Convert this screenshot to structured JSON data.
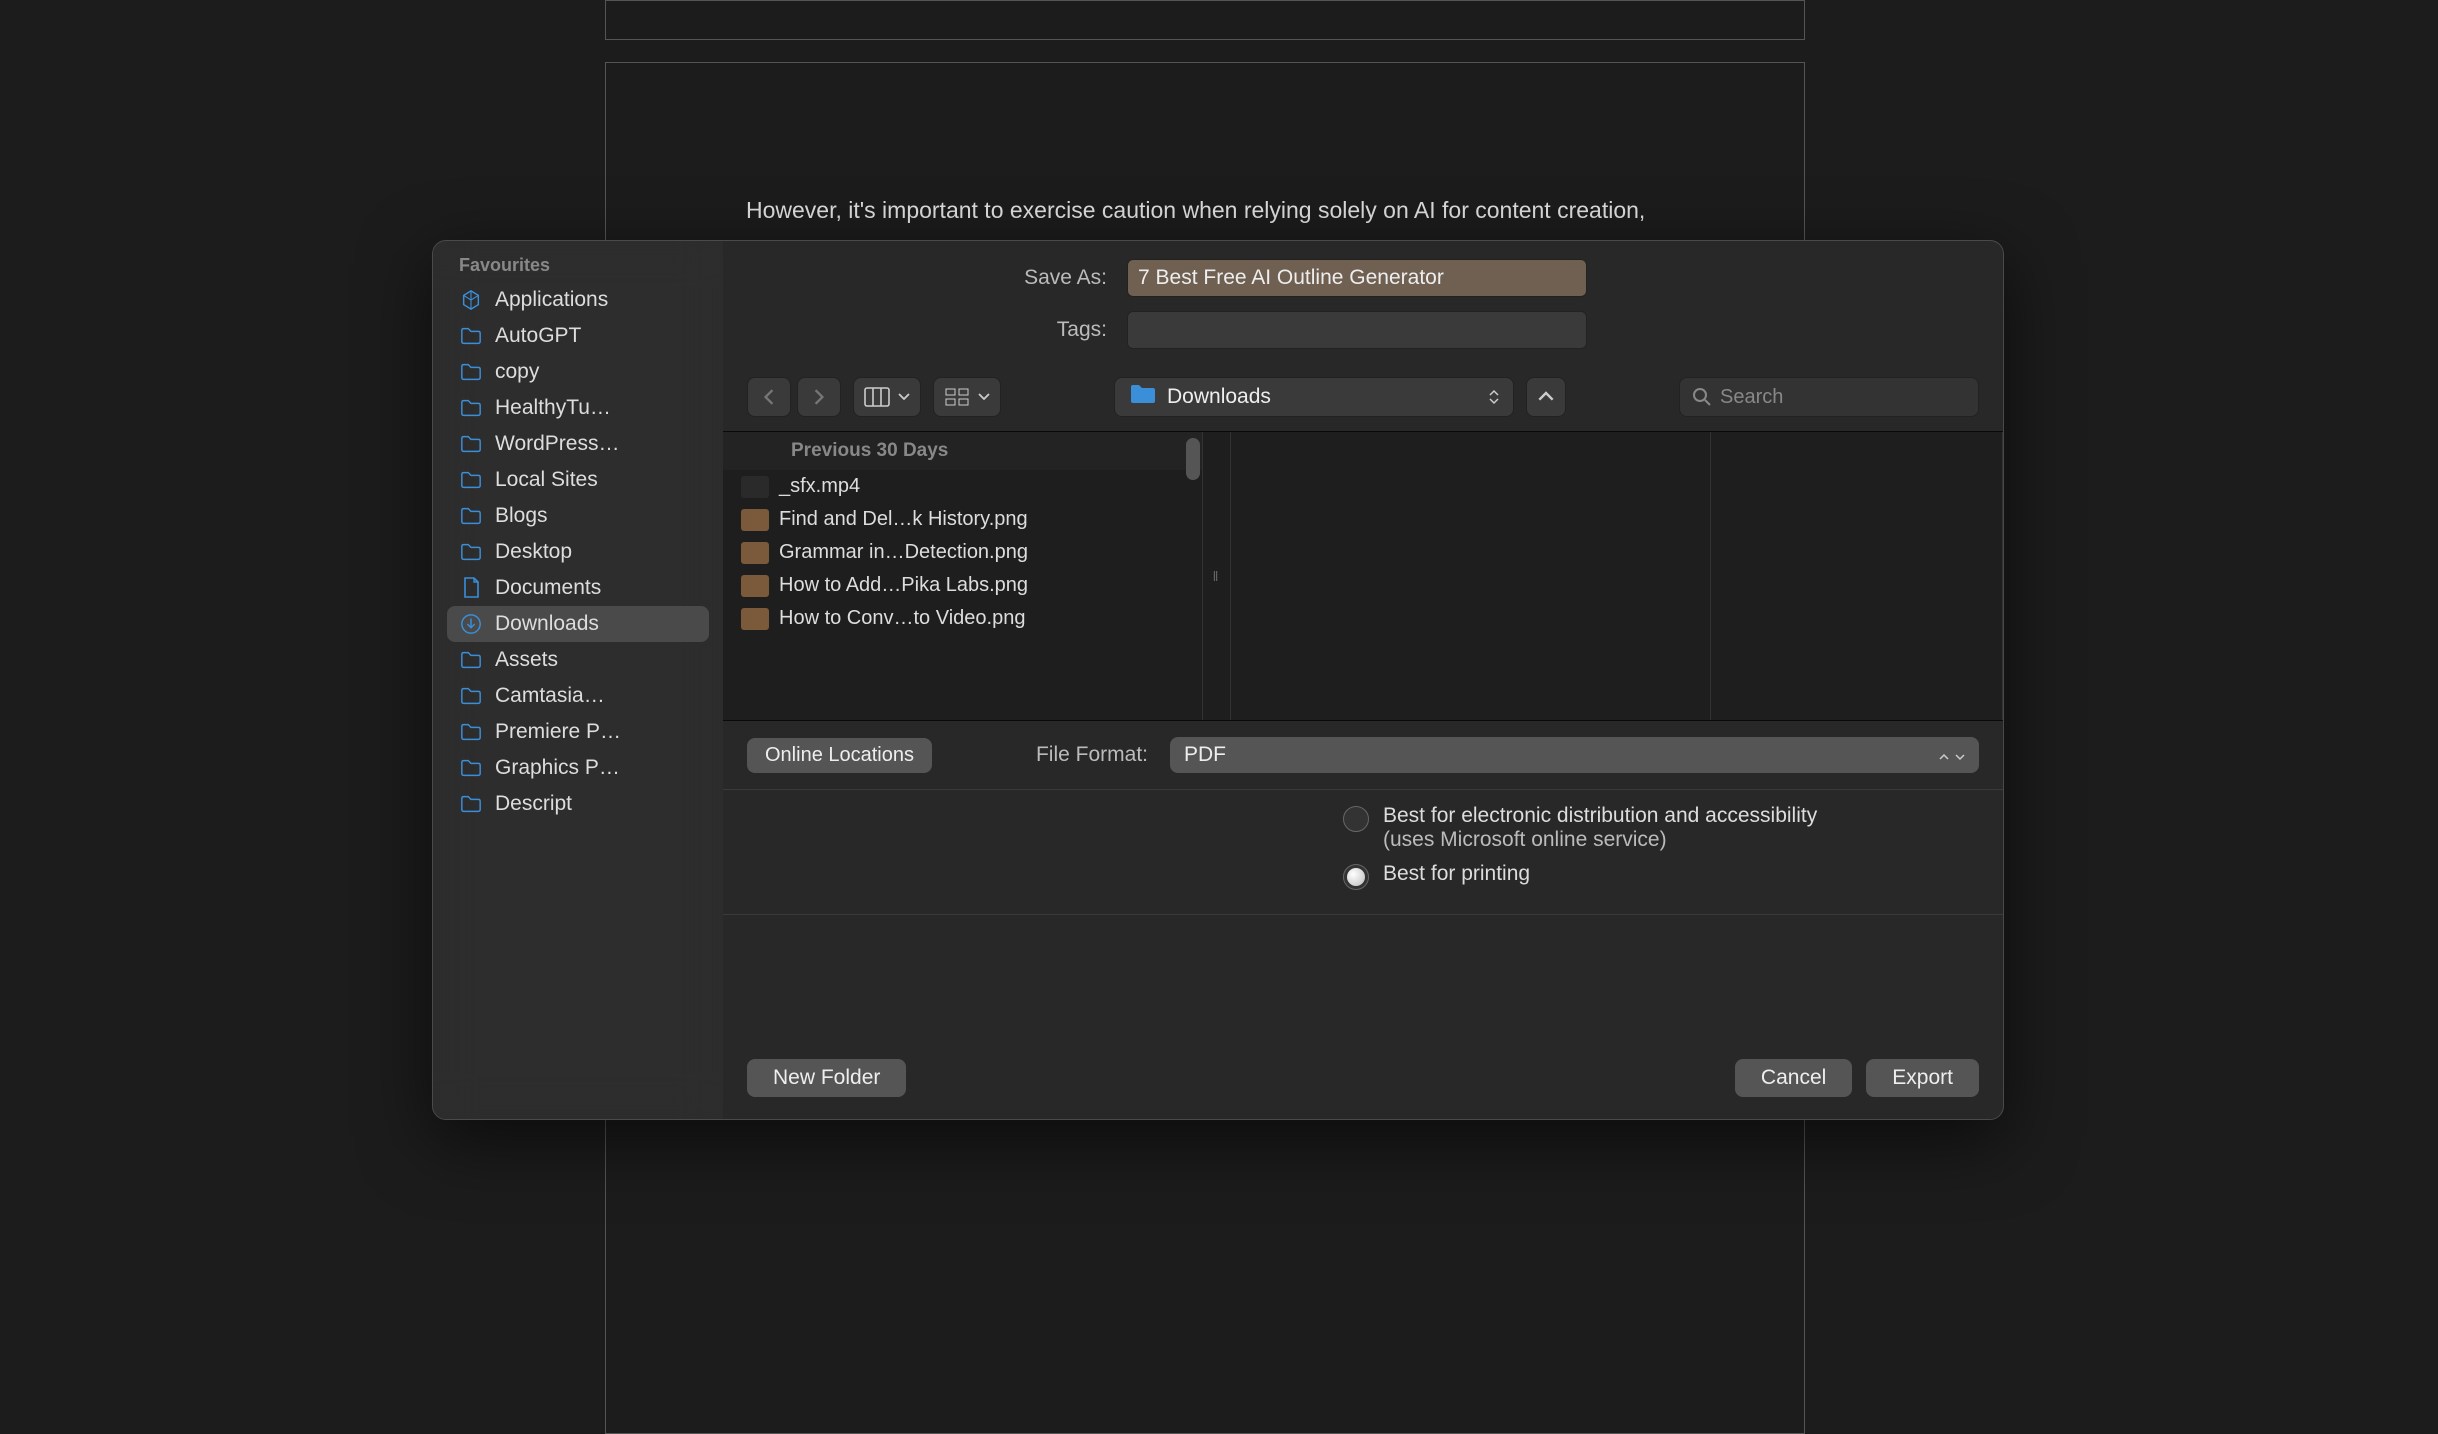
{
  "background": {
    "paragraph": "However, it's important to exercise caution when relying solely on AI for content creation, as"
  },
  "dialog": {
    "sidebar_heading": "Favourites",
    "sidebar": [
      {
        "icon": "apps",
        "label": "Applications"
      },
      {
        "icon": "folder",
        "label": "AutoGPT"
      },
      {
        "icon": "folder",
        "label": "copy"
      },
      {
        "icon": "folder",
        "label": "HealthyTu…"
      },
      {
        "icon": "folder",
        "label": "WordPress…"
      },
      {
        "icon": "folder",
        "label": "Local Sites"
      },
      {
        "icon": "folder",
        "label": "Blogs"
      },
      {
        "icon": "folder",
        "label": "Desktop"
      },
      {
        "icon": "doc",
        "label": "Documents"
      },
      {
        "icon": "download",
        "label": "Downloads",
        "selected": true
      },
      {
        "icon": "folder",
        "label": "Assets"
      },
      {
        "icon": "folder",
        "label": "Camtasia…"
      },
      {
        "icon": "folder",
        "label": "Premiere P…"
      },
      {
        "icon": "folder",
        "label": "Graphics P…"
      },
      {
        "icon": "folder",
        "label": "Descript"
      }
    ],
    "save_as_label": "Save As:",
    "save_as_value": "7 Best Free AI Outline Generator",
    "tags_label": "Tags:",
    "tags_value": "",
    "location_label": "Downloads",
    "search_placeholder": "Search",
    "group_header": "Previous 30 Days",
    "files": [
      {
        "kind": "vid",
        "name": "_sfx.mp4"
      },
      {
        "kind": "img",
        "name": "Find and Del…k History.png"
      },
      {
        "kind": "img",
        "name": "Grammar in…Detection.png"
      },
      {
        "kind": "img",
        "name": "How to Add…Pika Labs.png"
      },
      {
        "kind": "img",
        "name": "How to Conv…to Video.png"
      }
    ],
    "online_locations_label": "Online Locations",
    "file_format_label": "File Format:",
    "file_format_value": "PDF",
    "radio1_line1": "Best for electronic distribution and accessibility",
    "radio1_line2": "(uses Microsoft online service)",
    "radio2": "Best for printing",
    "new_folder_label": "New Folder",
    "cancel_label": "Cancel",
    "export_label": "Export"
  }
}
